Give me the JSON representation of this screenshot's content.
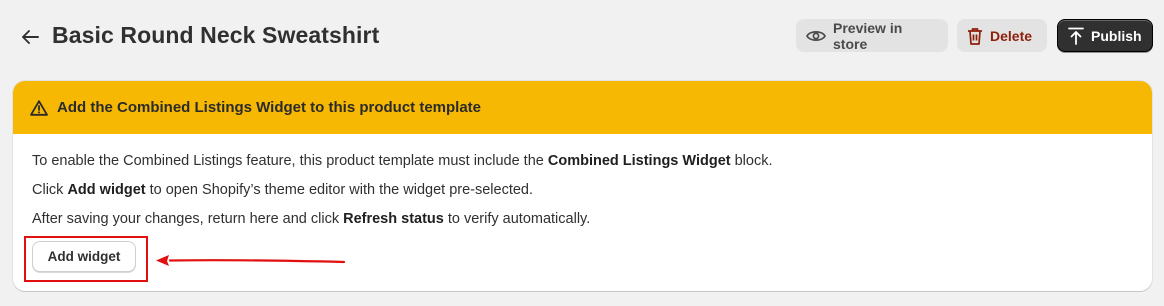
{
  "header": {
    "back_icon": "arrow-left-icon",
    "title": "Basic Round Neck Sweatshirt",
    "preview_label": "Preview in store",
    "preview_icon": "eye-icon",
    "delete_label": "Delete",
    "delete_icon": "trash-icon",
    "publish_label": "Publish",
    "publish_icon": "upload-icon"
  },
  "banner": {
    "icon": "warning-icon",
    "title": "Add the Combined Listings Widget to this product template",
    "line1_pre": "To enable the Combined Listings feature, this product template must include the ",
    "line1_bold": "Combined Listings Widget",
    "line1_post": " block.",
    "line2_pre": "Click ",
    "line2_bold": "Add widget",
    "line2_post": " to open Shopify’s theme editor with the widget pre-selected.",
    "line3_pre": "After saving your changes, return here and click ",
    "line3_bold": "Refresh status",
    "line3_post": " to verify automatically.",
    "button_label": "Add widget"
  },
  "annotation": {
    "highlight_color": "#e20f0f"
  },
  "colors": {
    "warning": "#f6b803",
    "publish_bg": "#303030",
    "delete_text": "#8e1f0b",
    "page_bg": "#f1f1f1"
  }
}
